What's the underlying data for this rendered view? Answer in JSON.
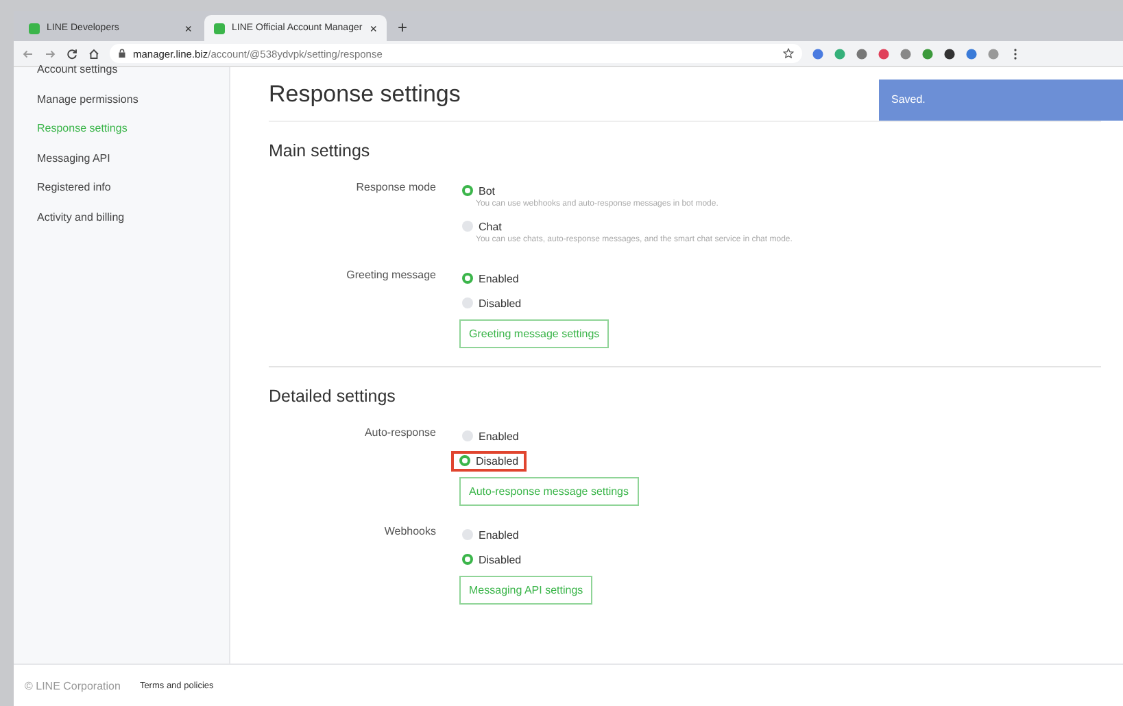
{
  "browser": {
    "tabs": [
      {
        "title": "LINE Developers",
        "close": "×",
        "selected": false
      },
      {
        "title": "LINE Official Account Manager",
        "close": "×",
        "selected": true
      }
    ],
    "new_tab": "+",
    "url_host": "manager.line.biz",
    "url_path": "/account/@538ydvpk/setting/response"
  },
  "sidebar": {
    "items": [
      {
        "label": "Account settings",
        "selected": false
      },
      {
        "label": "Manage permissions",
        "selected": false
      },
      {
        "label": "Response settings",
        "selected": true
      },
      {
        "label": "Messaging API",
        "selected": false
      },
      {
        "label": "Registered info",
        "selected": false
      },
      {
        "label": "Activity and billing",
        "selected": false
      }
    ]
  },
  "page_title": "Response settings",
  "toast": "Saved.",
  "sections": [
    {
      "title": "Main settings",
      "settings": [
        {
          "label": "Response mode",
          "options": [
            {
              "label": "Bot",
              "selected": true,
              "highlighted": false,
              "description": "You can use webhooks and auto-response messages in bot mode."
            },
            {
              "label": "Chat",
              "selected": false,
              "highlighted": false,
              "description": "You can use chats, auto-response messages, and the smart chat service in chat mode."
            }
          ]
        },
        {
          "label": "Greeting message",
          "options": [
            {
              "label": "Enabled",
              "selected": true,
              "highlighted": false
            },
            {
              "label": "Disabled",
              "selected": false,
              "highlighted": false
            }
          ],
          "button": "Greeting message settings"
        }
      ]
    },
    {
      "title": "Detailed settings",
      "settings": [
        {
          "label": "Auto-response",
          "options": [
            {
              "label": "Enabled",
              "selected": false,
              "highlighted": false
            },
            {
              "label": "Disabled",
              "selected": true,
              "highlighted": true
            }
          ],
          "button": "Auto-response message settings"
        },
        {
          "label": "Webhooks",
          "options": [
            {
              "label": "Enabled",
              "selected": false,
              "highlighted": false
            },
            {
              "label": "Disabled",
              "selected": true,
              "highlighted": false
            }
          ],
          "button": "Messaging API settings"
        }
      ]
    }
  ],
  "footer": {
    "copyright": "© LINE Corporation",
    "link": "Terms and policies"
  }
}
